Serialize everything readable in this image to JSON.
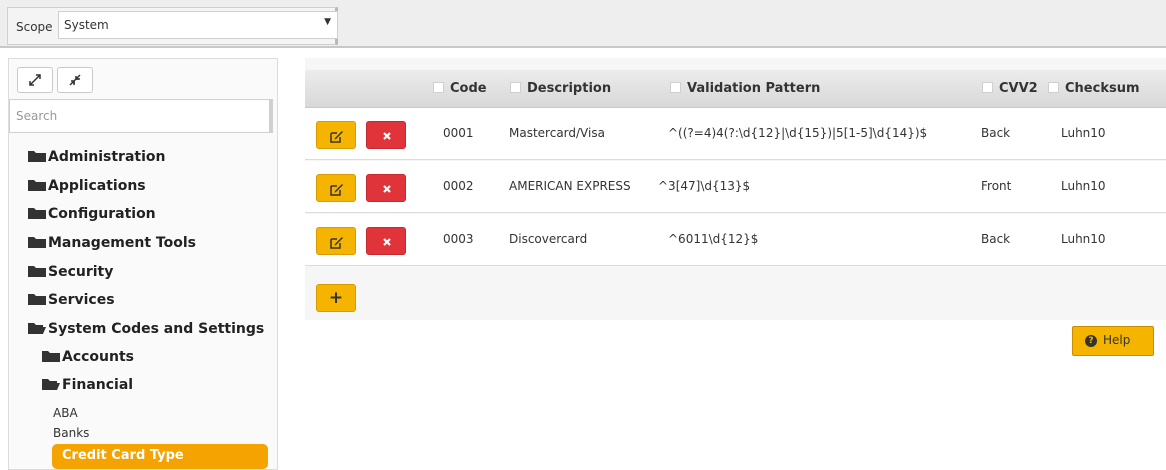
{
  "scope": {
    "label": "Scope",
    "value": "System"
  },
  "search": {
    "placeholder": "Search"
  },
  "tree": {
    "folders": [
      {
        "label": "Administration",
        "open": false
      },
      {
        "label": "Applications",
        "open": false
      },
      {
        "label": "Configuration",
        "open": false
      },
      {
        "label": "Management Tools",
        "open": false
      },
      {
        "label": "Security",
        "open": false
      },
      {
        "label": "Services",
        "open": false
      },
      {
        "label": "System Codes and Settings",
        "open": true
      },
      {
        "label": "Accounts",
        "open": false
      },
      {
        "label": "Financial",
        "open": true
      }
    ],
    "leaves": [
      {
        "label": "ABA"
      },
      {
        "label": "Banks"
      },
      {
        "label": "Credit Card Type",
        "selected": true
      }
    ]
  },
  "grid": {
    "columns": [
      "Code",
      "Description",
      "Validation Pattern",
      "CVV2",
      "Checksum"
    ],
    "rows": [
      {
        "code": "0001",
        "description": "Mastercard/Visa",
        "pattern": "^((?=4)4(?:\\d{12}|\\d{15})|5[1-5]\\d{14})$",
        "cvv2": "Back",
        "checksum": "Luhn10"
      },
      {
        "code": "0002",
        "description": "AMERICAN EXPRESS",
        "pattern": "^3[47]\\d{13}$",
        "cvv2": "Front",
        "checksum": "Luhn10"
      },
      {
        "code": "0003",
        "description": "Discovercard",
        "pattern": "^6011\\d{12}$",
        "cvv2": "Back",
        "checksum": "Luhn10"
      }
    ],
    "add_label": "+"
  },
  "help": {
    "label": "Help",
    "icon": "question-circle-icon"
  },
  "colors": {
    "accent": "#f4b400",
    "danger": "#e0343a",
    "selected": "#f5a300"
  }
}
